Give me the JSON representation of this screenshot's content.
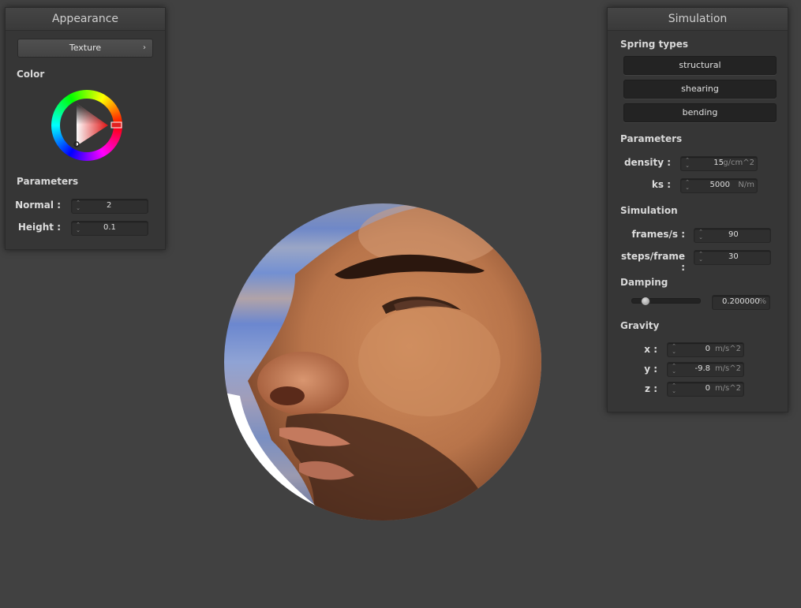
{
  "appearance": {
    "title": "Appearance",
    "texture_label": "Texture",
    "chevron": "›",
    "color_label": "Color",
    "color_value": "#e02020",
    "parameters_label": "Parameters",
    "normal_label": "Normal :",
    "normal_value": "2",
    "height_label": "Height :",
    "height_value": "0.1"
  },
  "simulation": {
    "title": "Simulation",
    "spring_types_label": "Spring types",
    "spring_buttons": [
      "structural",
      "shearing",
      "bending"
    ],
    "parameters_label": "Parameters",
    "density_label": "density :",
    "density_value": "15",
    "density_unit": "g/cm^2",
    "ks_label": "ks :",
    "ks_value": "5000",
    "ks_unit": "N/m",
    "simulation_label": "Simulation",
    "fps_label": "frames/s :",
    "fps_value": "90",
    "steps_label": "steps/frame :",
    "steps_value": "30",
    "damping_label": "Damping",
    "damping_value": "0.200000",
    "damping_unit": "%",
    "damping_fraction": 0.2,
    "gravity_label": "Gravity",
    "gx_label": "x :",
    "gx_value": "0",
    "gy_label": "y :",
    "gy_value": "-9.8",
    "gz_label": "z :",
    "gz_value": "0",
    "gravity_unit": "m/s^2"
  },
  "icons": {
    "spin": "spinner-arrows-icon",
    "chevron": "chevron-right-icon"
  }
}
